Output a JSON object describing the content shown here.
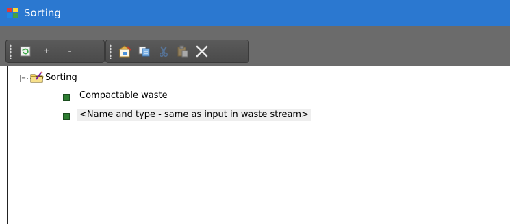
{
  "window": {
    "title": "Sorting"
  },
  "toolbar1": {
    "buttons": [
      {
        "icon": "refresh-icon"
      },
      {
        "label": "+"
      },
      {
        "label": "-"
      }
    ]
  },
  "toolbar2": {
    "buttons": [
      {
        "icon": "properties-icon"
      },
      {
        "icon": "copy-icon"
      },
      {
        "icon": "cut-icon"
      },
      {
        "icon": "paste-icon"
      },
      {
        "icon": "delete-icon"
      }
    ]
  },
  "tree": {
    "root": {
      "label": "Sorting",
      "expanded": true,
      "expander": "−"
    },
    "children": [
      {
        "label": "Compactable waste",
        "selected": false
      },
      {
        "label": "<Name and type - same as input in waste stream>",
        "selected": true
      }
    ]
  },
  "colors": {
    "titlebar": "#2b78d0",
    "toolstrip": "#6b6b6b",
    "leaf": "#2e7d32"
  }
}
